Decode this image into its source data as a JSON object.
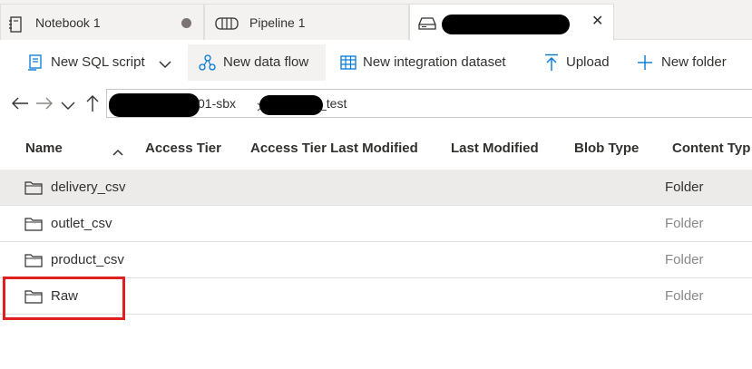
{
  "tabs": [
    {
      "label": "Notebook 1",
      "icon": "notebook-icon",
      "unsaved": true
    },
    {
      "label": "Pipeline 1",
      "icon": "pipeline-icon"
    },
    {
      "label": "",
      "icon": "storage-container-icon",
      "close": "✕",
      "active": true
    }
  ],
  "toolbar": {
    "new_sql_script": "New SQL script",
    "new_data_flow": "New data flow",
    "new_integration_dataset": "New integration dataset",
    "upload": "Upload",
    "new_folder": "New folder"
  },
  "breadcrumb": {
    "segment1": "01-sbx",
    "segment2": "_test"
  },
  "table": {
    "columns": [
      "Name",
      "Access Tier",
      "Access Tier Last Modified",
      "Last Modified",
      "Blob Type",
      "Content Typ"
    ],
    "rows": [
      {
        "name": "delivery_csv",
        "content_type": "Folder"
      },
      {
        "name": "outlet_csv",
        "content_type": "Folder"
      },
      {
        "name": "product_csv",
        "content_type": "Folder"
      },
      {
        "name": "Raw",
        "content_type": "Folder"
      }
    ]
  },
  "colors": {
    "accent": "#0078d4",
    "highlight": "#e02020",
    "selected_row": "#edebe9"
  }
}
